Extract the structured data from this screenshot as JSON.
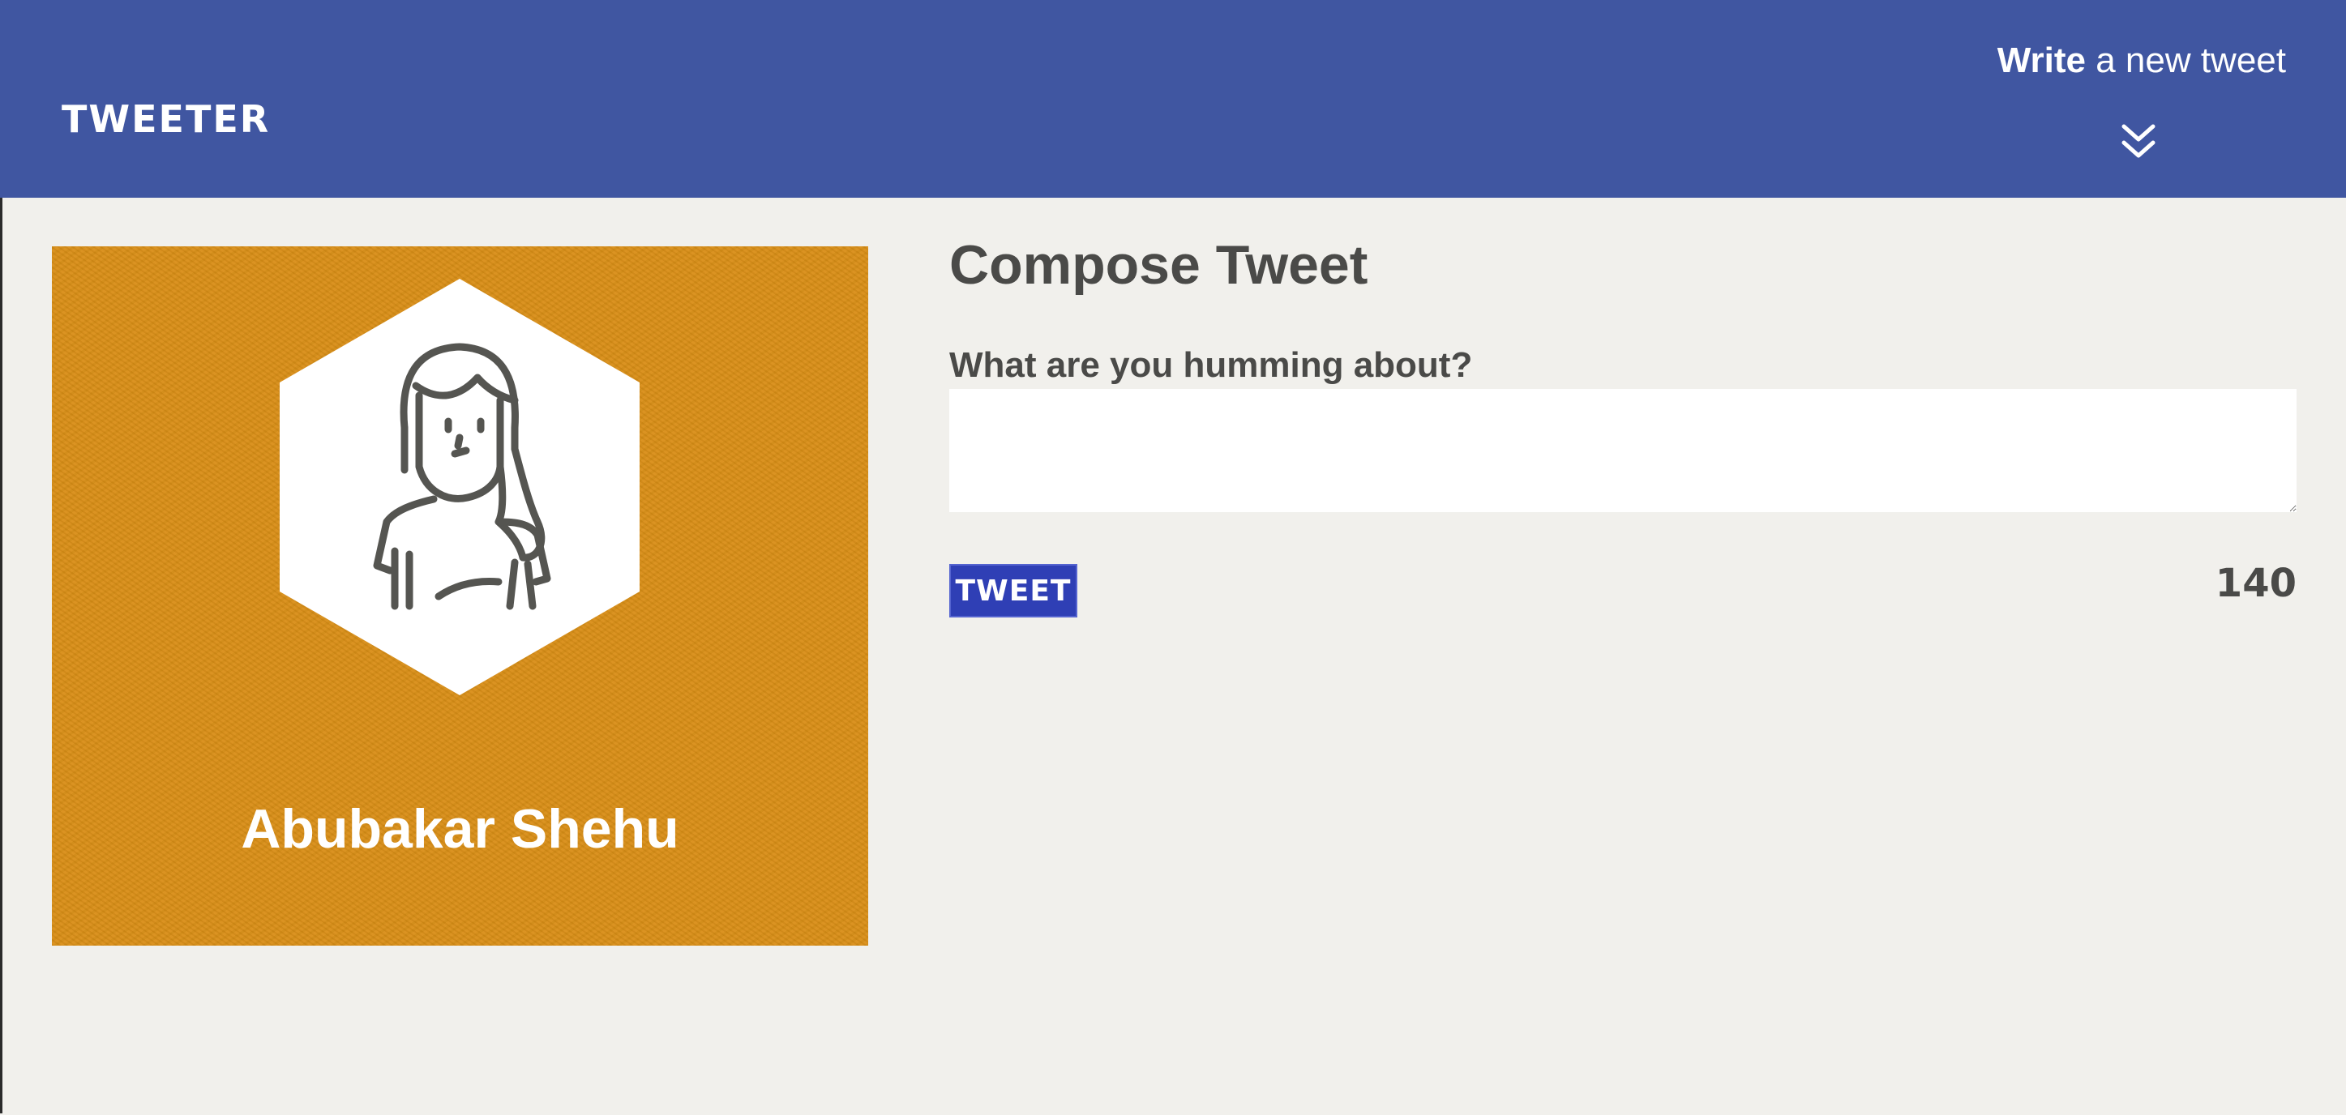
{
  "nav": {
    "brand": "TWEETER",
    "compose_toggle": {
      "bold": "Write",
      "rest": " a new tweet"
    },
    "icon": "double-chevron-down-icon"
  },
  "profile": {
    "name": "Abubakar Shehu",
    "avatar_icon": "person-avatar-icon"
  },
  "compose": {
    "title": "Compose Tweet",
    "prompt_label": "What are you humming about?",
    "input_value": "",
    "button_label": "Tweet",
    "char_counter": "140"
  },
  "colors": {
    "nav_bg": "#4056a1",
    "page_bg": "#f1f0ec",
    "profile_bg": "#d98e16",
    "button_bg": "#2f3fb5",
    "text_dark": "#4a4a48"
  }
}
